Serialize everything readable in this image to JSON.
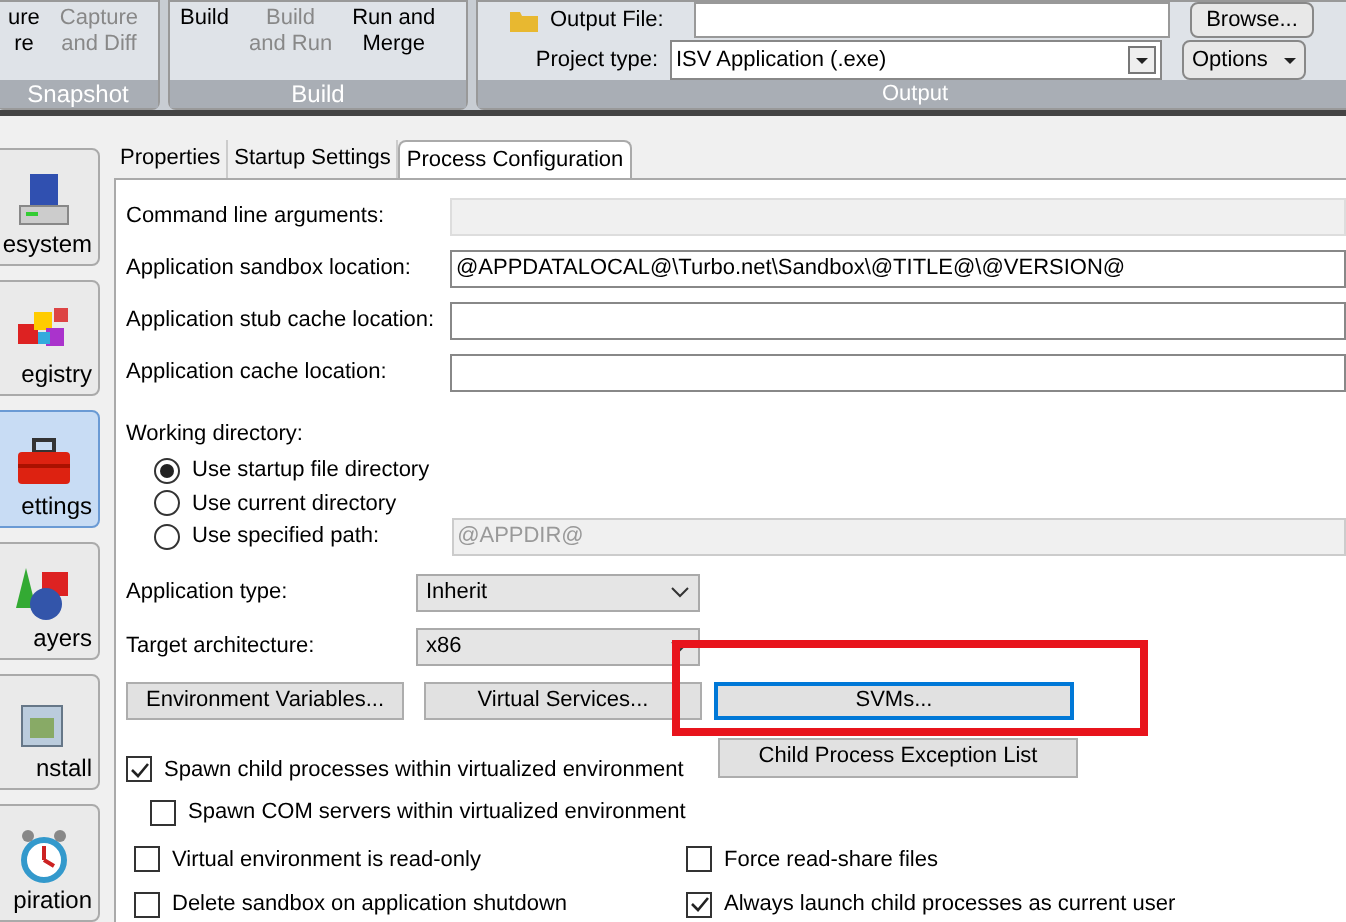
{
  "ribbon": {
    "groups": [
      {
        "label": "Snapshot",
        "buttons": [
          {
            "label": "ure\nre",
            "disabled": false
          },
          {
            "label": "Capture\nand Diff",
            "disabled": true
          }
        ]
      },
      {
        "label": "Build",
        "buttons": [
          {
            "label": "Build",
            "disabled": false
          },
          {
            "label": "Build\nand Run",
            "disabled": true
          },
          {
            "label": "Run and\nMerge",
            "disabled": false
          }
        ]
      }
    ],
    "output": {
      "label": "Output",
      "output_file_label": "Output File:",
      "browse": "Browse...",
      "project_type_label": "Project type:",
      "project_type": "ISV Application (.exe)",
      "options": "Options"
    }
  },
  "sidebar": {
    "items": [
      {
        "label": "esystem",
        "selected": false,
        "kind": "disk"
      },
      {
        "label": "egistry",
        "selected": false,
        "kind": "blocks"
      },
      {
        "label": "ettings",
        "selected": true,
        "kind": "toolbox"
      },
      {
        "label": "ayers",
        "selected": false,
        "kind": "shapes"
      },
      {
        "label": "nstall",
        "selected": false,
        "kind": "box"
      },
      {
        "label": "piration",
        "selected": false,
        "kind": "clock"
      }
    ]
  },
  "tabs": [
    {
      "label": "Properties",
      "selected": false
    },
    {
      "label": "Startup Settings",
      "selected": false
    },
    {
      "label": "Process Configuration",
      "selected": true
    }
  ],
  "fields": [
    {
      "label": "Command line arguments:",
      "disabled": true
    },
    {
      "label": "Application sandbox location:",
      "value": "@APPDATALOCAL@\\Turbo.net\\Sandbox\\@TITLE@\\@VERSION@",
      "disabled": false
    },
    {
      "label": "Application stub cache location:",
      "disabled": false
    },
    {
      "label": "Application cache location:",
      "disabled": false
    }
  ],
  "working_directory": {
    "label": "Working directory:",
    "options": [
      {
        "label": "Use startup file directory",
        "selected": true
      },
      {
        "label": "Use current directory",
        "selected": false
      },
      {
        "label": "Use specified path:",
        "selected": false
      }
    ],
    "path": "@APPDIR@"
  },
  "application_type": {
    "label": "Application type:",
    "value": "Inherit"
  },
  "target_architecture": {
    "label": "Target architecture:",
    "value": "x86"
  },
  "buttons": [
    {
      "label": "Environment Variables...",
      "focused": false
    },
    {
      "label": "Virtual Services...",
      "focused": false
    },
    {
      "label": "SVMs...",
      "focused": true
    }
  ],
  "child_process_button": "Child Process Exception List",
  "spawn_child": {
    "label": "Spawn child processes within virtualized environment",
    "checked": true
  },
  "spawn_com": {
    "label": "Spawn COM servers within virtualized environment",
    "checked": false
  },
  "options": [
    {
      "label": "Virtual environment is read-only",
      "checked": false
    },
    {
      "label": "Force read-share files",
      "checked": false
    },
    {
      "label": "Delete sandbox on application shutdown",
      "checked": false
    },
    {
      "label": "Always launch child processes as current user",
      "checked": true
    }
  ],
  "highlight": {
    "shown": true
  }
}
